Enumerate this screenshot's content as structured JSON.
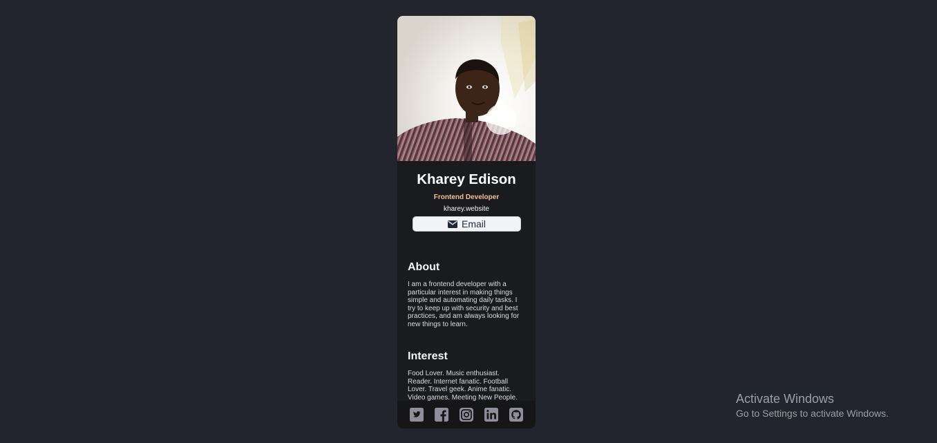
{
  "profile": {
    "name": "Kharey Edison",
    "role": "Frontend Developer",
    "website": "kharey.website",
    "email_label": "Email",
    "photo": "profile-photo"
  },
  "about": {
    "title": "About",
    "body": "I am a frontend developer with a particular interest in making things simple and automating daily tasks. I try to keep up with security and best practices, and am always looking for new things to learn."
  },
  "interest": {
    "title": "Interest",
    "body": "Food Lover. Music enthusiast. Reader. Internet fanatic. Football Lover. Travel geek. Anime fanatic. Video games. Meeting New People."
  },
  "socials": [
    {
      "icon": "twitter-icon"
    },
    {
      "icon": "facebook-icon"
    },
    {
      "icon": "instagram-icon"
    },
    {
      "icon": "linkedin-icon"
    },
    {
      "icon": "github-icon"
    }
  ],
  "watermark": {
    "title": "Activate Windows",
    "subtitle": "Go to Settings to activate Windows."
  },
  "colors": {
    "page_background": "#23252e",
    "card_background": "#1a1b1f",
    "footer_background": "#161619",
    "accent": "#f3bf99",
    "button_background": "#f3f4f6",
    "social_icon": "#918e9b"
  }
}
